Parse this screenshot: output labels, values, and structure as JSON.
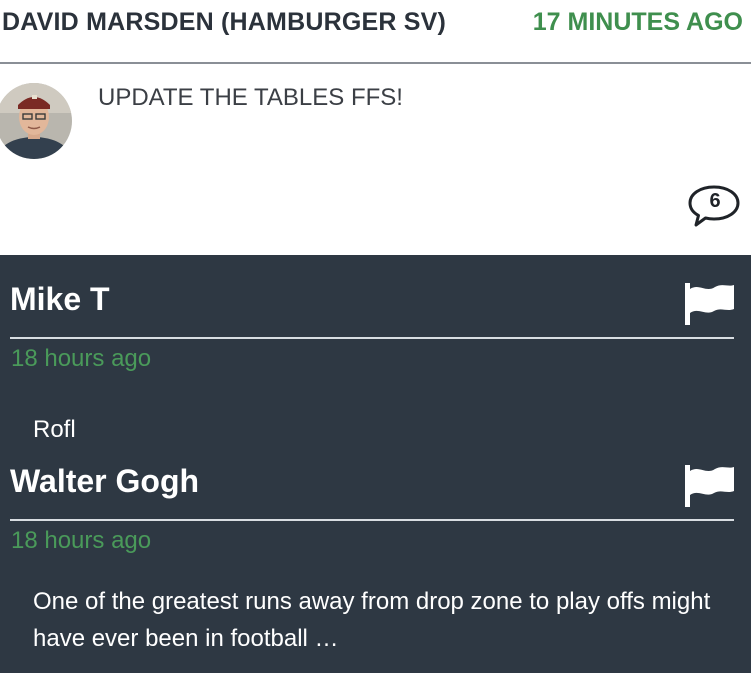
{
  "post": {
    "author": "DAVID MARSDEN (HAMBURGER SV)",
    "time": "17 MINUTES AGO",
    "text": "UPDATE THE TABLES FFS!",
    "comment_count": "6",
    "avatar_icon": "user-avatar-photo",
    "comment_icon": "speech-bubble-icon"
  },
  "comments": [
    {
      "name": "Mike T",
      "time": "18 hours ago",
      "text": "Rofl",
      "flag_icon": "flag-icon"
    },
    {
      "name": "Walter Gogh",
      "time": "18 hours ago",
      "text": "One of the greatest runs away from drop zone to play offs might have ever been in football …",
      "flag_icon": "flag-icon"
    }
  ],
  "colors": {
    "accent_green": "#3f8f4e",
    "comments_bg": "#2e3843",
    "header_text": "#2b323b"
  }
}
